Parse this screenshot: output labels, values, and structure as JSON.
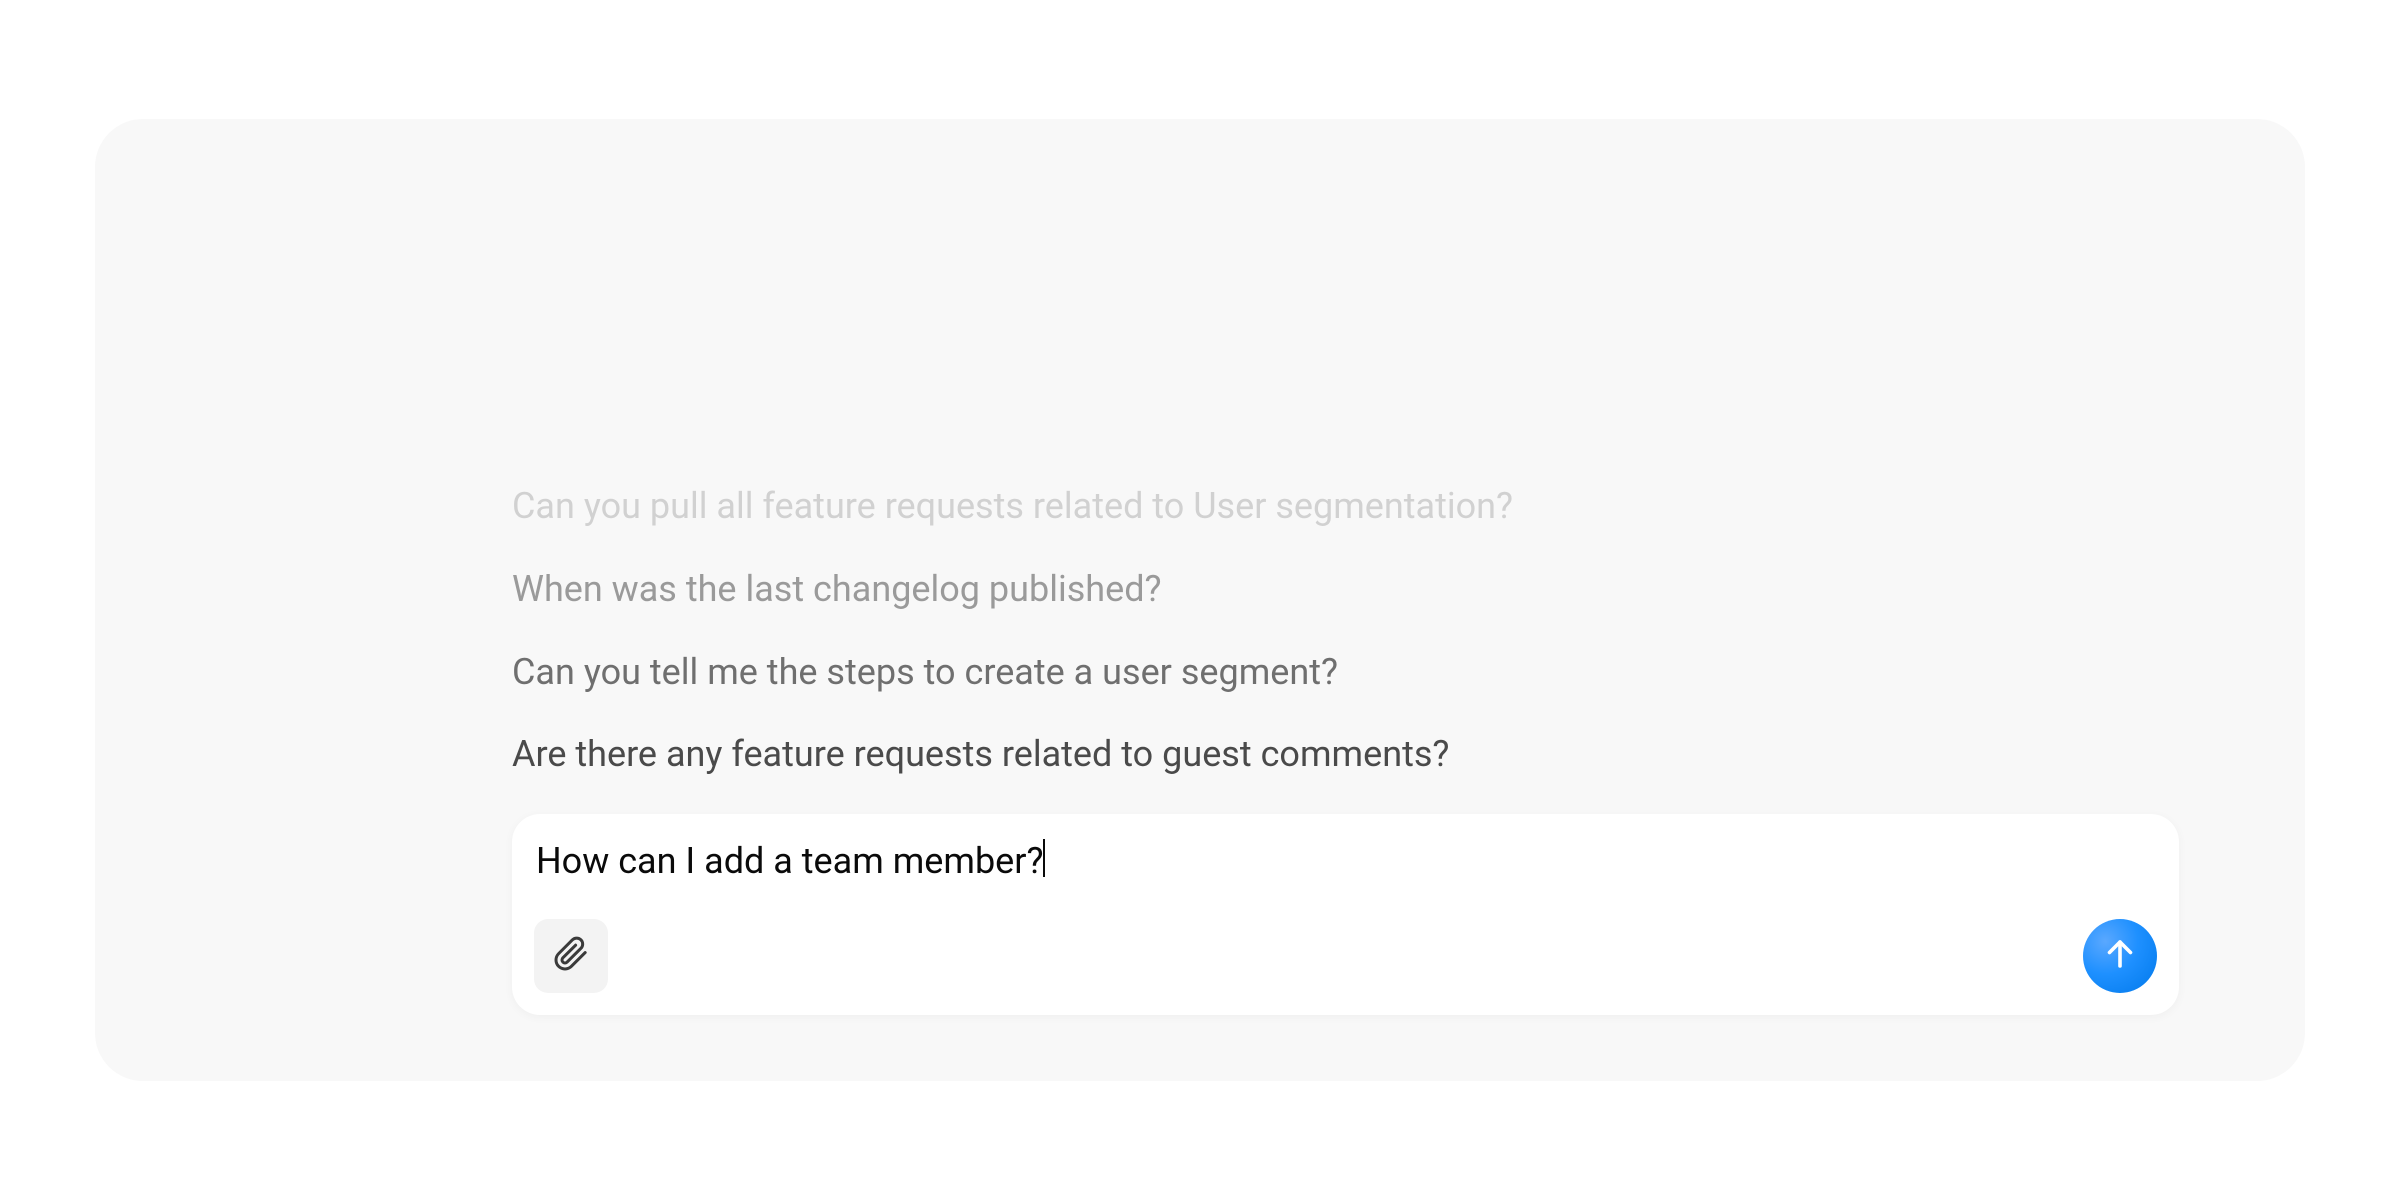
{
  "suggestions": [
    "Can you pull all feature requests related to User segmentation?",
    "When was the last changelog published?",
    "Can you tell me the steps to create a user segment?",
    "Are there any feature requests related to guest comments?"
  ],
  "input": {
    "value": "How can I add a team member?"
  },
  "icons": {
    "attach": "paperclip-icon",
    "send": "arrow-up-icon"
  },
  "colors": {
    "panel_bg": "#f8f8f8",
    "card_bg": "#ffffff",
    "send_gradient_start": "#5aa8ff",
    "send_gradient_end": "#0078ea"
  }
}
